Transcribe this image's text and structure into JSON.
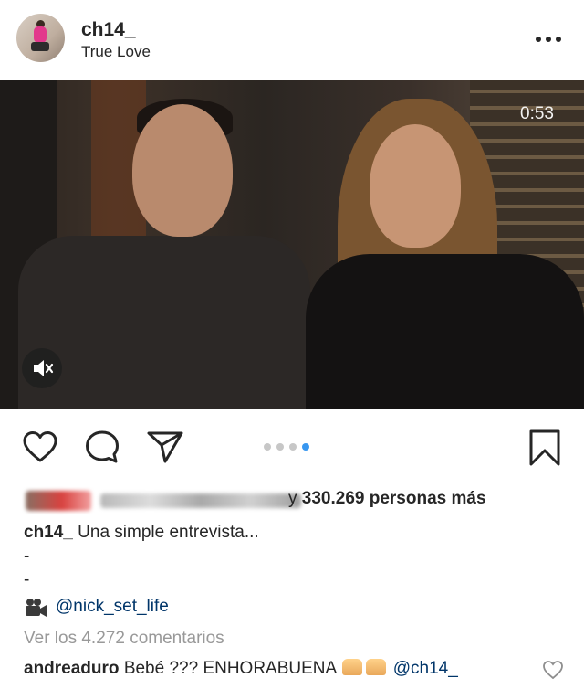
{
  "post": {
    "username": "ch14_",
    "location": "True Love",
    "more_icon": "more-horizontal-icon",
    "media": {
      "duration": "0:53",
      "muted": true,
      "carousel_count": 4,
      "carousel_active_index": 3
    },
    "likes": {
      "suffix_text": "y",
      "count_text": "330.269 personas más"
    },
    "caption": {
      "username": "ch14_",
      "text": "Una simple entrevista...",
      "lines": [
        "-",
        "-"
      ]
    },
    "mention": {
      "icon": "movie-camera-icon",
      "text": "@nick_set_life"
    },
    "view_comments": "Ver los 4.272 comentarios",
    "comment": {
      "username": "andreaduro",
      "text": "Bebé ??? ENHORABUENA",
      "emoji": "raising-hands-emoji",
      "mention": "@ch14_"
    },
    "colors": {
      "text": "#262626",
      "link": "#003569",
      "muted": "#999999",
      "carousel_active": "#3897f0",
      "carousel_inactive": "#c7c7c7"
    }
  }
}
